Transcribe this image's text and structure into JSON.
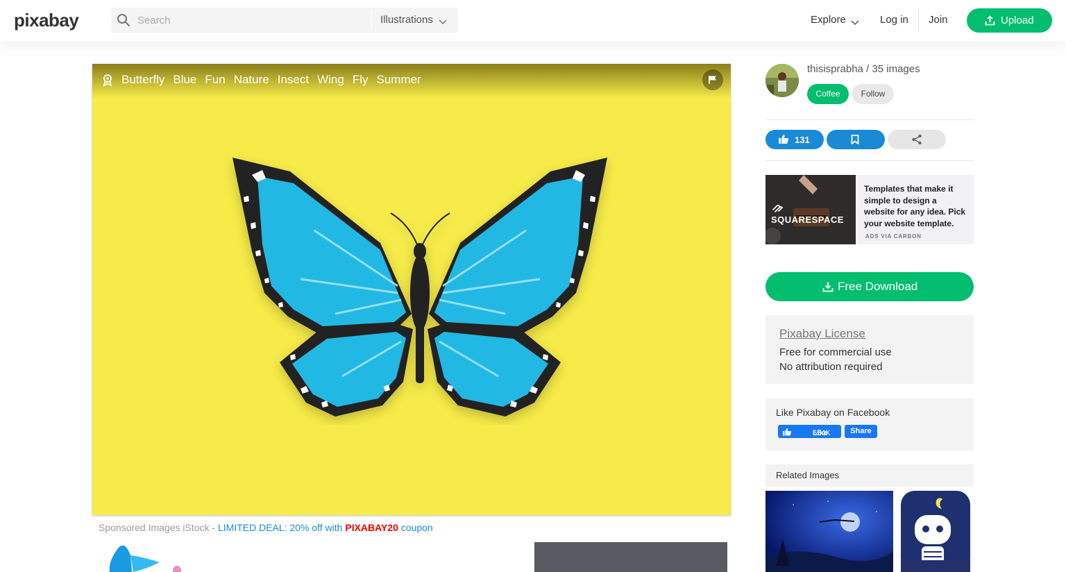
{
  "header": {
    "logo": "pixabay",
    "search_placeholder": "Search",
    "search_type": "Illustrations",
    "explore": "Explore",
    "login": "Log in",
    "join": "Join",
    "upload": "Upload"
  },
  "image": {
    "tags": [
      "Butterfly",
      "Blue",
      "Fun",
      "Nature",
      "Insect",
      "Wing",
      "Fly",
      "Summer"
    ]
  },
  "sponsored": {
    "prefix": "Sponsored Images iStock - ",
    "deal": "LIMITED DEAL: 20% off with ",
    "code": "PIXABAY20",
    "suffix": " coupon"
  },
  "author": {
    "name": "thisisprabha",
    "separator": " / ",
    "images": "35 images",
    "coffee": "Coffee",
    "follow": "Follow"
  },
  "actions": {
    "likes": "131"
  },
  "ad": {
    "brand": "SQUARESPACE",
    "text": "Templates that make it simple to design a website for any idea. Pick your website template.",
    "via": "ADS VIA CARBON"
  },
  "download": {
    "label": "Free Download"
  },
  "license": {
    "title": "Pixabay License",
    "line1": "Free for commercial use",
    "line2": "No attribution required"
  },
  "facebook": {
    "title": "Like Pixabay on Facebook",
    "like": "Like",
    "count": "654K",
    "share": "Share"
  },
  "related": {
    "title": "Related Images"
  },
  "colors": {
    "accent_green": "#02be6e",
    "action_blue": "#1a8ad6",
    "image_background": "#f6eb48"
  }
}
